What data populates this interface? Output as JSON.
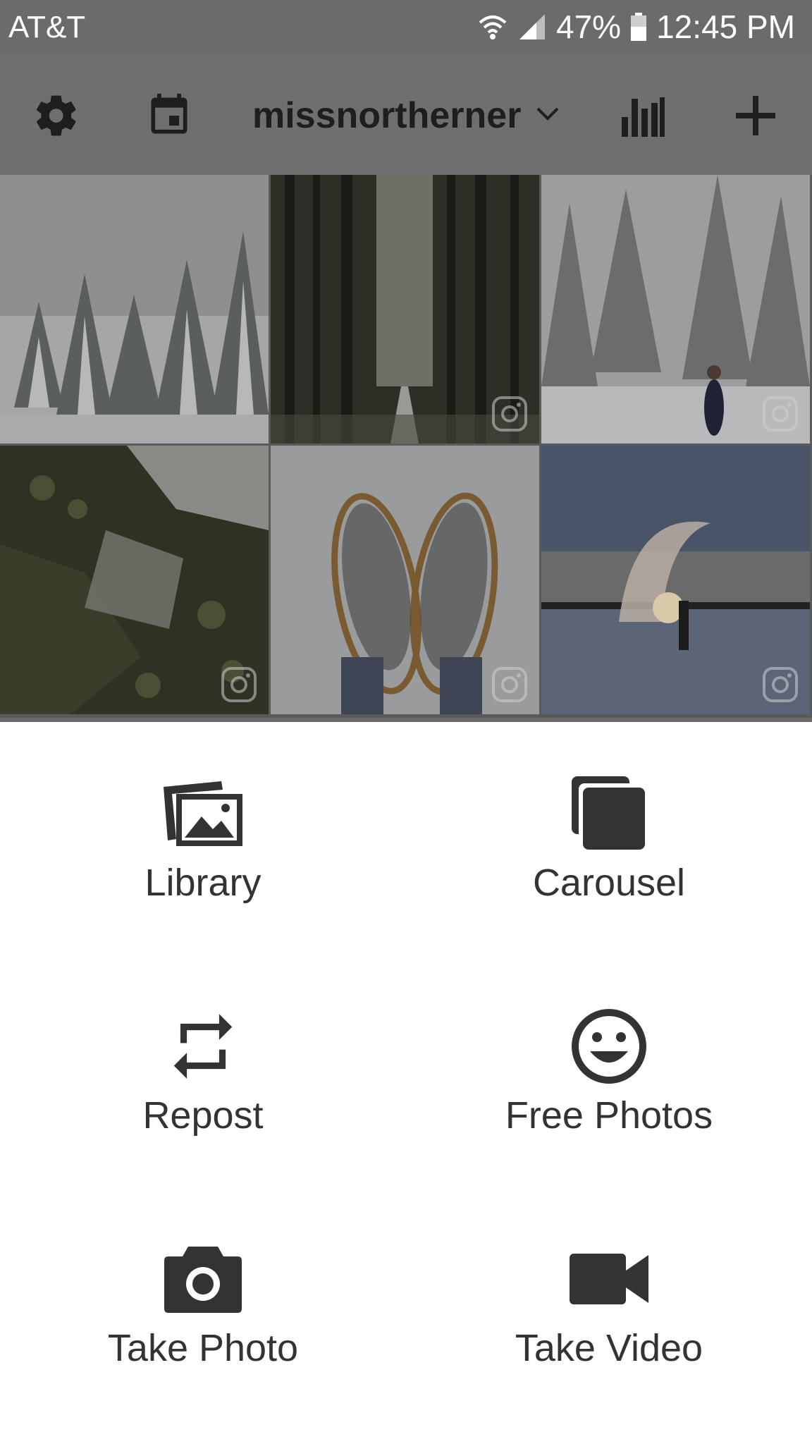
{
  "status_bar": {
    "carrier": "AT&T",
    "battery": "47%",
    "time": "12:45 PM",
    "icons": [
      "wifi-icon",
      "signal-icon",
      "battery-icon"
    ]
  },
  "app_bar": {
    "account_name": "missnortherner",
    "icons": [
      "gear-icon",
      "calendar-icon",
      "chevron-down-icon",
      "bar-chart-icon",
      "plus-icon"
    ]
  },
  "grid": {
    "tiles": [
      {
        "subject": "snowy-pines",
        "icon": "none"
      },
      {
        "subject": "pine-forest-road",
        "icon": "instagram-icon"
      },
      {
        "subject": "snowy-woods-person",
        "icon": "instagram-icon"
      },
      {
        "subject": "aerial-forest",
        "icon": "instagram-icon"
      },
      {
        "subject": "snowshoes",
        "icon": "instagram-icon"
      },
      {
        "subject": "frozen-lake-steam",
        "icon": "instagram-icon"
      }
    ]
  },
  "sheet": {
    "options": [
      {
        "label": "Library",
        "icon": "library-icon"
      },
      {
        "label": "Carousel",
        "icon": "carousel-icon"
      },
      {
        "label": "Repost",
        "icon": "repost-icon"
      },
      {
        "label": "Free Photos",
        "icon": "smiley-icon"
      },
      {
        "label": "Take Photo",
        "icon": "camera-icon"
      },
      {
        "label": "Take Video",
        "icon": "video-camera-icon"
      }
    ]
  },
  "colors": {
    "overlay_bar": "#6f6f6f",
    "icon_dark": "#1e1e1e",
    "sheet_icon": "#333333",
    "sheet_bg": "#ffffff"
  }
}
